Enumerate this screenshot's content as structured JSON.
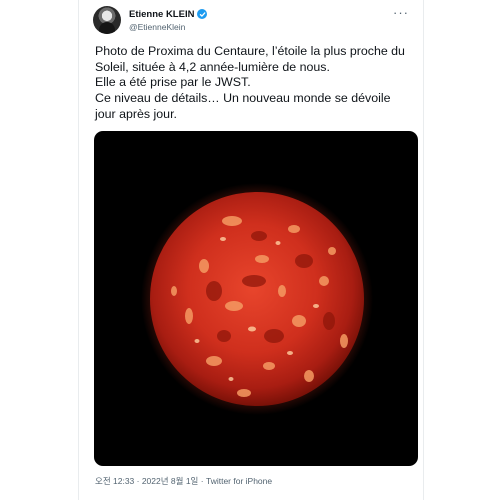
{
  "tweet": {
    "display_name": "Etienne KLEIN",
    "handle": "@EtienneKlein",
    "verified_icon": "verified-badge-icon",
    "more_icon": "more-horizontal-icon",
    "text_lines": [
      "Photo de Proxima du Centaure, l’étoile la plus proche du Soleil, située à 4,2 année-lumière de nous.",
      "Elle a été prise par le JWST.",
      "Ce niveau de détails… Un nouveau monde se dévoile jour après jour."
    ],
    "timestamp": "오전 12:33 · 2022년 8월 1일",
    "separator": "·",
    "source": "Twitter for iPhone"
  },
  "colors": {
    "text": "#0f1419",
    "secondary": "#536471",
    "verified": "#1d9bf0",
    "photo_background": "#000000",
    "planet": "#c8281b"
  }
}
